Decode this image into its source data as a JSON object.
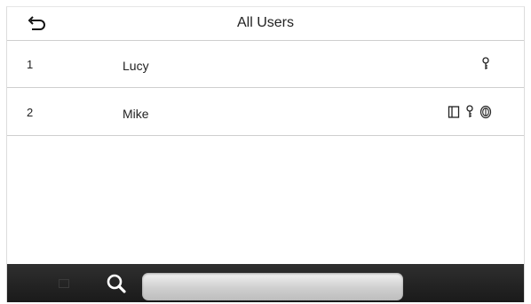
{
  "header": {
    "title": "All Users",
    "back_icon": "back-arrow-icon"
  },
  "users": [
    {
      "number": "1",
      "name": "Lucy",
      "credential_icons": [
        "password-key-icon"
      ]
    },
    {
      "number": "2",
      "name": "Mike",
      "credential_icons": [
        "card-icon",
        "password-key-icon",
        "fingerprint-icon"
      ]
    }
  ],
  "footer": {
    "search_icon": "search-icon",
    "search_value": "",
    "search_placeholder": ""
  },
  "colors": {
    "footer_bg": "#1f1f1f",
    "divider": "#cfcfcf",
    "text": "#222222"
  }
}
